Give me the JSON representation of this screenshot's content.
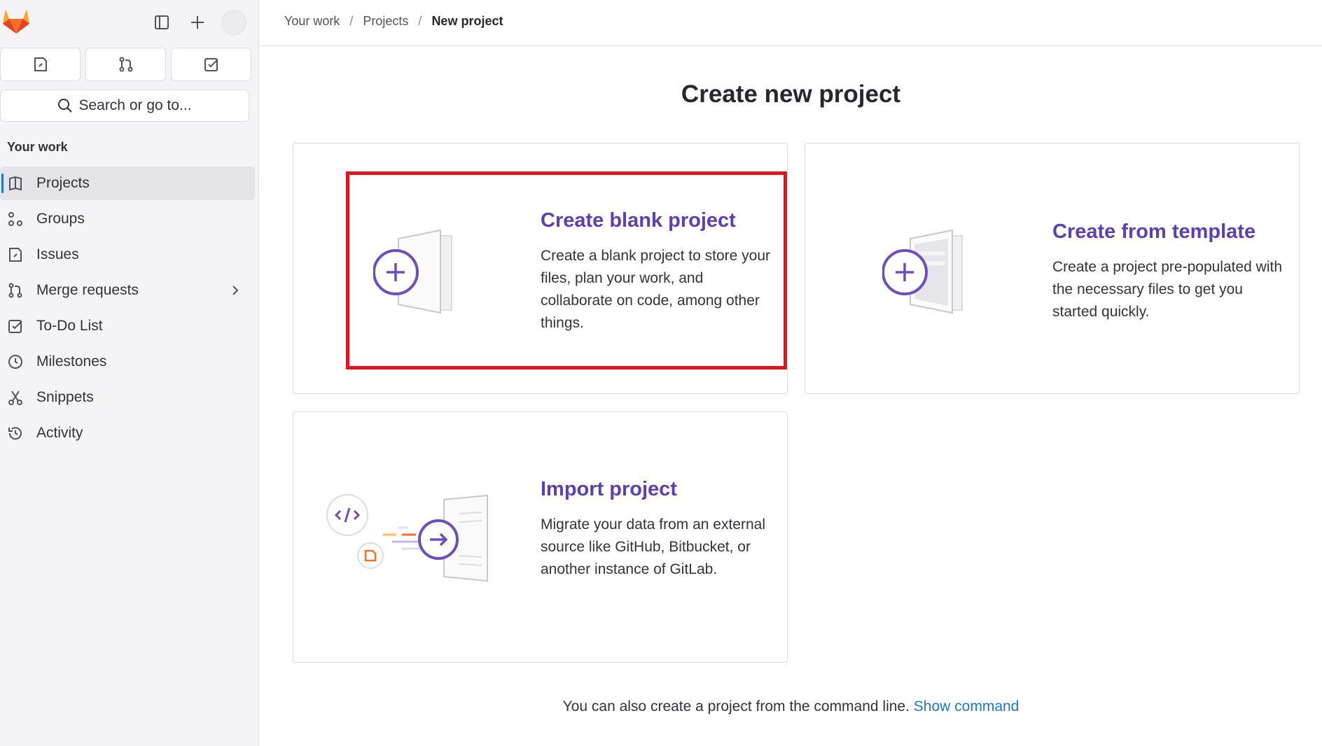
{
  "colors": {
    "accent": "#5b3fb3",
    "link": "#1f75cb",
    "highlight": "#e0141e",
    "orange": "#fc6d26"
  },
  "sidebar": {
    "search_placeholder": "Search or go to...",
    "section_title": "Your work",
    "items": [
      {
        "label": "Projects",
        "icon": "project-icon",
        "active": true
      },
      {
        "label": "Groups",
        "icon": "group-icon"
      },
      {
        "label": "Issues",
        "icon": "issues-icon"
      },
      {
        "label": "Merge requests",
        "icon": "merge-request-icon"
      },
      {
        "label": "To-Do List",
        "icon": "todo-icon"
      },
      {
        "label": "Milestones",
        "icon": "milestone-icon"
      },
      {
        "label": "Snippets",
        "icon": "snippet-icon"
      },
      {
        "label": "Activity",
        "icon": "history-icon"
      }
    ]
  },
  "breadcrumb": {
    "items": [
      "Your work",
      "Projects"
    ],
    "current": "New project"
  },
  "main": {
    "title": "Create new project",
    "cards": [
      {
        "title": "Create blank project",
        "description": "Create a blank project to store your files, plan your work, and collaborate on code, among other things."
      },
      {
        "title": "Create from template",
        "description": "Create a project pre-populated with the necessary files to get you started quickly."
      },
      {
        "title": "Import project",
        "description": "Migrate your data from an external source like GitHub, Bitbucket, or another instance of GitLab."
      }
    ],
    "footer_text": "You can also create a project from the command line.",
    "footer_link": "Show command"
  }
}
